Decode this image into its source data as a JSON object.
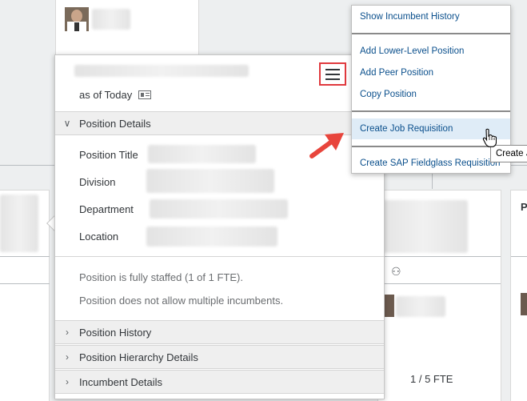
{
  "popover": {
    "as_of": "as of Today",
    "section_position_details": "Position Details",
    "fields": [
      {
        "label": "Position Title"
      },
      {
        "label": "Division"
      },
      {
        "label": "Department"
      },
      {
        "label": "Location"
      }
    ],
    "note_staffed": "Position is fully staffed (1 of 1 FTE).",
    "note_incumbents": "Position does not allow multiple incumbents.",
    "section_history": "Position History",
    "section_hierarchy": "Position Hierarchy Details",
    "section_incumbent": "Incumbent Details"
  },
  "context_menu": {
    "items": [
      "Show Incumbent History",
      "Add Lower-Level Position",
      "Add Peer Position",
      "Copy Position",
      "Create Job Requisition",
      "Create SAP Fieldglass Requisition"
    ]
  },
  "tooltip": "Create J",
  "background": {
    "fte_label": "1 / 5 FTE",
    "right_card_letter": "P"
  },
  "colors": {
    "link": "#0a4f8c",
    "highlight_border": "#e0393e",
    "arrow": "#e8453c",
    "hover_bg": "#dfecf7"
  }
}
